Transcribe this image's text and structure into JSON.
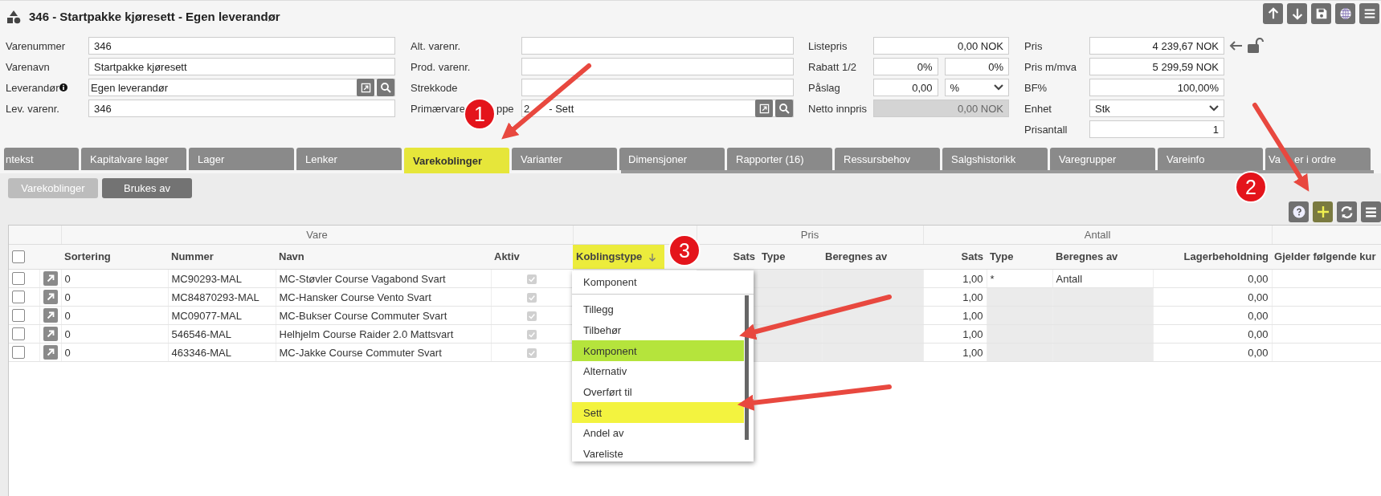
{
  "window": {
    "title": "346 - Startpakke kjøresett - Egen leverandør"
  },
  "form": {
    "columns": [
      [
        {
          "label": "Varenummer",
          "info": false,
          "kind": "text",
          "value": "346"
        },
        {
          "label": "Varenavn",
          "info": false,
          "kind": "text",
          "value": "Startpakke kjøresett"
        },
        {
          "label": "Leverandør",
          "info": true,
          "kind": "lookup",
          "value": "Egen leverandør"
        },
        {
          "label": "Lev. varenr.",
          "info": false,
          "kind": "text",
          "value": "346"
        }
      ],
      [
        {
          "label": "Alt. varenr.",
          "info": false,
          "kind": "text"
        },
        {
          "label": "Prod. varenr.",
          "info": false,
          "kind": "text"
        },
        {
          "label": "Strekkode",
          "info": false,
          "kind": "text"
        },
        {
          "label_parts": [
            "Primærvare",
            "ppe"
          ],
          "info": false,
          "kind": "lookup",
          "value_parts": [
            "2",
            "- Sett"
          ]
        }
      ],
      [
        {
          "label": "Listepris",
          "info": false,
          "kind": "text",
          "value": "0,00 NOK"
        },
        {
          "label": "Rabatt 1/2",
          "info": false,
          "kind": "pair",
          "values": [
            "0%",
            "0%"
          ]
        },
        {
          "label": "Påslag",
          "info": false,
          "kind": "number_select",
          "value": "0,00",
          "option": "%"
        },
        {
          "label": "Netto innpris",
          "info": false,
          "kind": "disabled",
          "value": "0,00 NOK"
        }
      ],
      [
        {
          "label": "Pris",
          "info": false,
          "kind": "price",
          "value": "4 239,67 NOK"
        },
        {
          "label": "Pris m/mva",
          "info": false,
          "kind": "text",
          "value": "5 299,59 NOK"
        },
        {
          "label": "BF%",
          "info": false,
          "kind": "text",
          "value": "100,00%"
        },
        {
          "label": "Enhet",
          "info": false,
          "kind": "select",
          "value": "Stk"
        },
        {
          "label": "Prisantall",
          "info": false,
          "kind": "text",
          "value": "1"
        }
      ]
    ]
  },
  "tabs": [
    {
      "label": "ntekst",
      "selected": false
    },
    {
      "label": "Kapitalvare lager",
      "selected": false
    },
    {
      "label": "Lager",
      "selected": false
    },
    {
      "label": "Lenker",
      "selected": false
    },
    {
      "label": "Varekoblinger",
      "selected": true
    },
    {
      "label": "Varianter",
      "selected": false
    },
    {
      "label": "Dimensjoner",
      "selected": false
    },
    {
      "label": "Rapporter (16)",
      "selected": false
    },
    {
      "label": "Ressursbehov",
      "selected": false
    },
    {
      "label": "Salgshistorikk",
      "selected": false
    },
    {
      "label": "Varegrupper",
      "selected": false
    },
    {
      "label": "Vareinfo",
      "selected": false
    },
    {
      "label_parts": [
        "Va",
        "er i ordre"
      ],
      "selected": false
    }
  ],
  "subtabs": [
    {
      "label": "Varekoblinger",
      "selected": true
    },
    {
      "label": "Brukes av",
      "selected": false
    }
  ],
  "table": {
    "all_checked": false,
    "column_groups": [
      {
        "label": "Vare",
        "columns": [
          {
            "label": "Sortering",
            "kind": "text",
            "sorted": false,
            "highlighted": false
          },
          {
            "label": "Nummer",
            "kind": "text",
            "sorted": false,
            "highlighted": false
          },
          {
            "label": "Navn",
            "kind": "text",
            "sorted": false,
            "highlighted": false
          },
          {
            "label": "Aktiv",
            "kind": "text",
            "sorted": false,
            "highlighted": false
          }
        ]
      },
      {
        "columns": [
          {
            "label": "Koblingstype",
            "kind": "text",
            "sorted": true,
            "highlighted": true
          }
        ]
      },
      {
        "label": "Pris",
        "columns": [
          {
            "label": "Sats",
            "kind": "number",
            "sorted": false,
            "highlighted": false
          },
          {
            "label": "Type",
            "kind": "text",
            "sorted": false,
            "highlighted": false
          },
          {
            "label": "Beregnes av",
            "kind": "text",
            "sorted": false,
            "highlighted": false
          }
        ]
      },
      {
        "label": "Antall",
        "columns": [
          {
            "label": "Sats",
            "kind": "number",
            "sorted": false,
            "highlighted": false
          },
          {
            "label": "Type",
            "kind": "text",
            "sorted": false,
            "highlighted": false
          },
          {
            "label": "Beregnes av",
            "kind": "text",
            "sorted": false,
            "highlighted": false
          },
          {
            "label": "Lagerbeholdning",
            "kind": "number",
            "sorted": false,
            "highlighted": false
          }
        ]
      },
      {
        "columns": [
          {
            "label": "Gjelder følgende kur",
            "kind": "text",
            "sorted": false,
            "highlighted": false
          }
        ]
      }
    ],
    "rows": [
      {
        "checked": false,
        "sortering": "0",
        "nummer": "MC90293-MAL",
        "navn": "MC-Støvler Course Vagabond Svart",
        "aktiv": true,
        "antall_sats": "1,00",
        "antall_type": "*",
        "antall_beregnes_av": "Antall",
        "antall_locked": false,
        "lagerbeholdning": "0,00"
      },
      {
        "checked": false,
        "sortering": "0",
        "nummer": "MC84870293-MAL",
        "navn": "MC-Hansker Course Vento Svart",
        "aktiv": true,
        "antall_sats": "1,00",
        "antall_locked": true,
        "lagerbeholdning": "0,00"
      },
      {
        "checked": false,
        "sortering": "0",
        "nummer": "MC09077-MAL",
        "navn": "MC-Bukser Course Commuter Svart",
        "aktiv": true,
        "antall_sats": "1,00",
        "antall_locked": true,
        "lagerbeholdning": "0,00"
      },
      {
        "checked": false,
        "sortering": "0",
        "nummer": "546546-MAL",
        "navn": "Helhjelm Course Raider 2.0 Mattsvart",
        "aktiv": true,
        "antall_sats": "1,00",
        "antall_locked": true,
        "lagerbeholdning": "0,00"
      },
      {
        "checked": false,
        "sortering": "0",
        "nummer": "463346-MAL",
        "navn": "MC-Jakke Course Commuter Svart",
        "aktiv": true,
        "antall_sats": "1,00",
        "antall_locked": true,
        "lagerbeholdning": "0,00"
      }
    ]
  },
  "dropdown": {
    "current": "Komponent",
    "options": [
      {
        "label": "Tillegg"
      },
      {
        "label": "Tilbehør"
      },
      {
        "label": "Komponent",
        "color": "#b5e43c"
      },
      {
        "label": "Alternativ"
      },
      {
        "label": "Overført til"
      },
      {
        "label": "Sett",
        "color": "#f3f33f"
      },
      {
        "label": "Andel av"
      },
      {
        "label": "Vareliste"
      }
    ]
  },
  "callouts": [
    {
      "label": "1"
    },
    {
      "label": "2"
    },
    {
      "label": "3"
    }
  ]
}
